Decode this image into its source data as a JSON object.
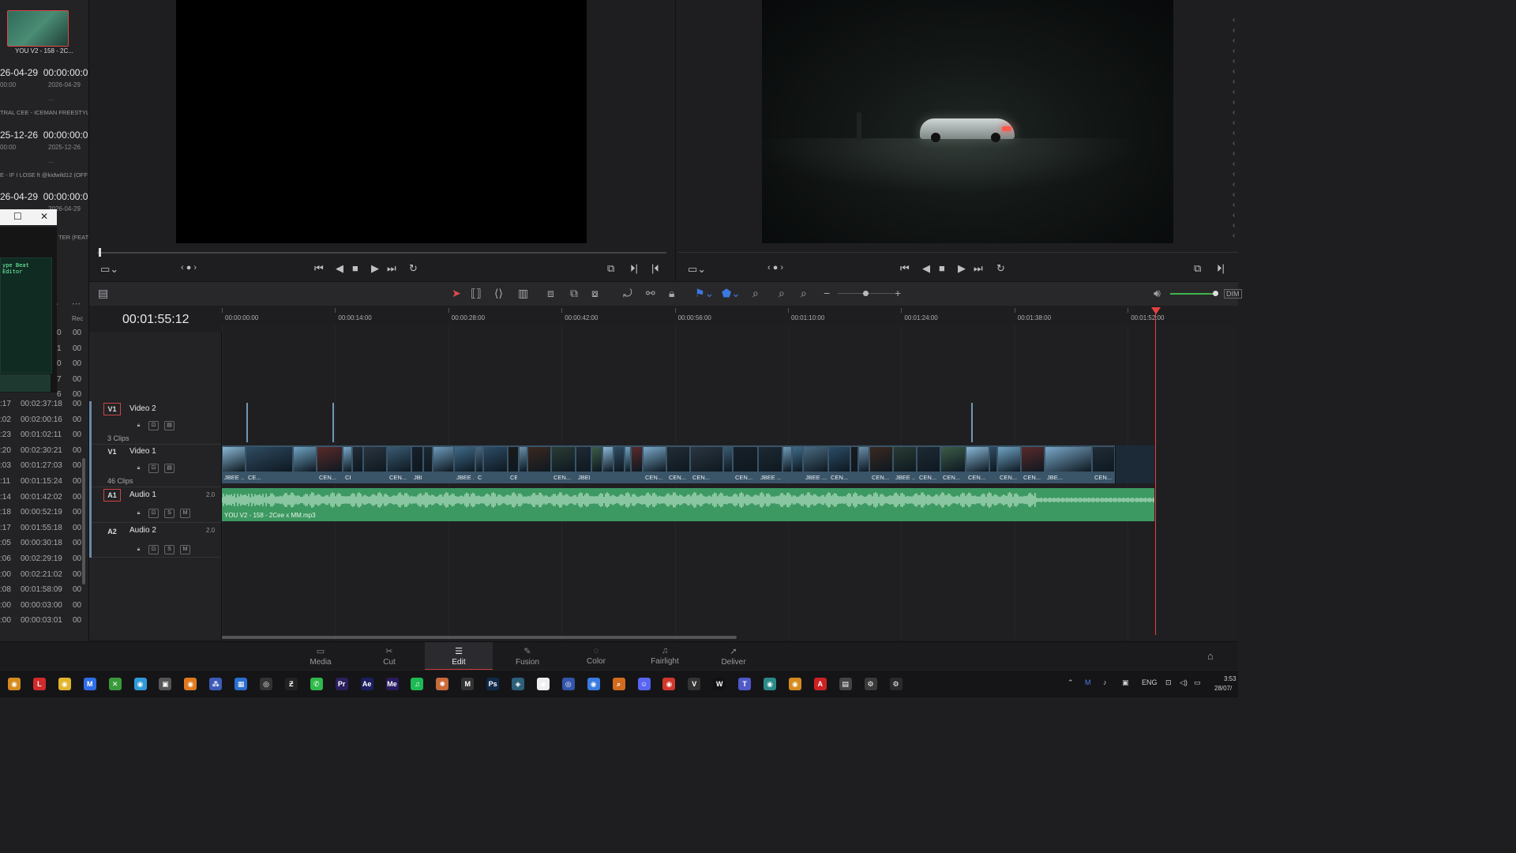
{
  "media_pool": {
    "thumb_name": "YOU V2 - 158 - 2C...",
    "entries": [
      {
        "date": "26-04-29",
        "tc": "00:00:00:0(",
        "sub_left": "00:00",
        "sub_right": "2026-04-29",
        "dash": "...",
        "song": "TRAL CEE - ICEMAN FREESTYLI"
      },
      {
        "date": "25-12-26",
        "tc": "00:00:00:0(",
        "sub_left": "00:00",
        "sub_right": "2025-12-26",
        "dash": "...",
        "song": "E - IF I LOSE ft @kidwild12 (OFF"
      },
      {
        "date": "26-04-29",
        "tc": "00:00:00:0(",
        "sub_left": "",
        "sub_right": "2026-04-29",
        "dash": "",
        "song": "TER (FEAT"
      }
    ],
    "col_header": "Rec",
    "left_col_top": [
      "0",
      "1",
      "0",
      "7",
      "6"
    ],
    "right_col_top": [
      "00",
      "00",
      "00",
      "00",
      "00"
    ],
    "rows": [
      {
        "a": ":17",
        "b": "00:02:37:18",
        "c": "00"
      },
      {
        "a": ":02",
        "b": "00:02:00:16",
        "c": "00"
      },
      {
        "a": ":23",
        "b": "00:01:02:11",
        "c": "00"
      },
      {
        "a": ":20",
        "b": "00:02:30:21",
        "c": "00"
      },
      {
        "a": ":03",
        "b": "00:01:27:03",
        "c": "00"
      },
      {
        "a": ":11",
        "b": "00:01:15:24",
        "c": "00"
      },
      {
        "a": ":14",
        "b": "00:01:42:02",
        "c": "00"
      },
      {
        "a": ":18",
        "b": "00:00:52:19",
        "c": "00"
      },
      {
        "a": ":17",
        "b": "00:01:55:18",
        "c": "00"
      },
      {
        "a": ":05",
        "b": "00:00:30:18",
        "c": "00"
      },
      {
        "a": ":06",
        "b": "00:02:29:19",
        "c": "00"
      },
      {
        "a": ":00",
        "b": "00:02:21:02",
        "c": "00"
      },
      {
        "a": ":08",
        "b": "00:01:58:09",
        "c": "00"
      },
      {
        "a": ":00",
        "b": "00:00:03:00",
        "c": "00"
      },
      {
        "a": ":00",
        "b": "00:00:03:01",
        "c": "00"
      }
    ]
  },
  "floating_window": {
    "maximize": "☐",
    "close": "✕",
    "body_text": "ype Beat Editor"
  },
  "timeline": {
    "timecode": "00:01:55:12",
    "ruler": [
      "00:00:00:00",
      "00:00:14:00",
      "00:00:28:00",
      "00:00:42:00",
      "00:00:56:00",
      "00:01:10:00",
      "00:01:24:00",
      "00:01:38:00",
      "00:01:52:00"
    ],
    "tracks": {
      "v2": {
        "badge": "V1",
        "name": "Video 2",
        "clips": "3 Clips"
      },
      "v1": {
        "badge": "V1",
        "name": "Video 1",
        "clips": "46 Clips"
      },
      "a1": {
        "badge": "A1",
        "name": "Audio 1",
        "ch": "2.0",
        "s": "S",
        "m": "M"
      },
      "a2": {
        "badge": "A2",
        "name": "Audio 2",
        "ch": "2.0",
        "s": "S",
        "m": "M"
      }
    },
    "audio_clip_name": "YOU V2 - 158 - 2Cee x MM.mp3",
    "clip_labels": [
      "JBEE ...",
      "CE...",
      "",
      "CEN...",
      "CEN...",
      "",
      "",
      "CEN...",
      "JBEE ...",
      "",
      "",
      "JBEE ...",
      "CE...",
      "",
      "CEN...",
      "",
      "",
      "CEN...",
      "JBEE ...",
      "",
      "",
      "",
      "",
      "",
      "CEN...",
      "CEN...",
      "CEN...",
      "",
      "CEN...",
      "JBEE ...",
      "",
      "",
      "JBEE ...",
      "CEN...",
      "",
      "",
      "CEN...",
      "JBEE ...",
      "CEN...",
      "CEN...",
      "CEN...",
      "",
      "CEN...",
      "CEN...",
      "JBE...",
      "CEN..."
    ]
  },
  "toolbar": {
    "dim": "DIM"
  },
  "page_tabs": [
    {
      "label": "Media",
      "icon": "▭"
    },
    {
      "label": "Cut",
      "icon": "✂"
    },
    {
      "label": "Edit",
      "icon": "☰"
    },
    {
      "label": "Fusion",
      "icon": "✎"
    },
    {
      "label": "Color",
      "icon": "◌"
    },
    {
      "label": "Fairlight",
      "icon": "♫"
    },
    {
      "label": "Deliver",
      "icon": "➚"
    }
  ],
  "taskbar": {
    "apps": [
      {
        "name": "app-icon-1",
        "glyph": "◉",
        "color": "#d58a1e"
      },
      {
        "name": "app-icon-L",
        "glyph": "L",
        "color": "#d22a2a"
      },
      {
        "name": "app-icon-3",
        "glyph": "◉",
        "color": "#e1b52b"
      },
      {
        "name": "app-icon-m",
        "glyph": "M",
        "color": "#2f6ee8"
      },
      {
        "name": "app-icon-xbox",
        "glyph": "✕",
        "color": "#3a9a3a"
      },
      {
        "name": "app-icon-6",
        "glyph": "◉",
        "color": "#2f9ad8"
      },
      {
        "name": "app-icon-7",
        "glyph": "▣",
        "color": "#555"
      },
      {
        "name": "app-icon-8",
        "glyph": "◉",
        "color": "#e07a1e"
      },
      {
        "name": "app-icon-9",
        "glyph": "⁂",
        "color": "#3d5ab8"
      },
      {
        "name": "app-icon-10",
        "glyph": "▦",
        "color": "#2a6fd1"
      },
      {
        "name": "app-icon-11",
        "glyph": "◎",
        "color": "#333"
      },
      {
        "name": "app-icon-12",
        "glyph": "Ƶ",
        "color": "#222"
      },
      {
        "name": "app-icon-whatsapp",
        "glyph": "✆",
        "color": "#2fb94a"
      },
      {
        "name": "app-icon-pr",
        "glyph": "Pr",
        "color": "#2b1f5c"
      },
      {
        "name": "app-icon-ae",
        "glyph": "Ae",
        "color": "#1d1e5e"
      },
      {
        "name": "app-icon-me",
        "glyph": "Me",
        "color": "#2a1a5e"
      },
      {
        "name": "app-icon-spotify",
        "glyph": "♫",
        "color": "#1db954"
      },
      {
        "name": "app-icon-claude",
        "glyph": "✺",
        "color": "#c86a3a"
      },
      {
        "name": "app-icon-mix",
        "glyph": "M",
        "color": "#333"
      },
      {
        "name": "app-icon-ps",
        "glyph": "Ps",
        "color": "#0f2a48"
      },
      {
        "name": "app-icon-resolve",
        "glyph": "◈",
        "color": "#2b5f7a"
      },
      {
        "name": "app-icon-22",
        "glyph": "◉",
        "color": "#eee"
      },
      {
        "name": "app-icon-23",
        "glyph": "◎",
        "color": "#3355aa"
      },
      {
        "name": "app-icon-24",
        "glyph": "◉",
        "color": "#3a7be0"
      },
      {
        "name": "app-icon-search",
        "glyph": "⌕",
        "color": "#d36b1c"
      },
      {
        "name": "app-icon-discord",
        "glyph": "☺",
        "color": "#5865f2"
      },
      {
        "name": "app-icon-chrome",
        "glyph": "◉",
        "color": "#d2382c"
      },
      {
        "name": "app-icon-28",
        "glyph": "V",
        "color": "#333"
      },
      {
        "name": "app-icon-29",
        "glyph": "W",
        "color": "#111"
      },
      {
        "name": "app-icon-teams",
        "glyph": "T",
        "color": "#5059c9"
      },
      {
        "name": "app-icon-31",
        "glyph": "◉",
        "color": "#2a8a8a"
      },
      {
        "name": "app-icon-32",
        "glyph": "◉",
        "color": "#d58a1e"
      },
      {
        "name": "app-icon-acrobat",
        "glyph": "A",
        "color": "#c22"
      },
      {
        "name": "app-icon-calc",
        "glyph": "▤",
        "color": "#444"
      },
      {
        "name": "app-icon-settings",
        "glyph": "⚙",
        "color": "#3a3a3a"
      },
      {
        "name": "app-icon-36",
        "glyph": "⚙",
        "color": "#2a2a2a"
      }
    ],
    "lang": "ENG",
    "time": "3:53",
    "date": "28/07/"
  }
}
